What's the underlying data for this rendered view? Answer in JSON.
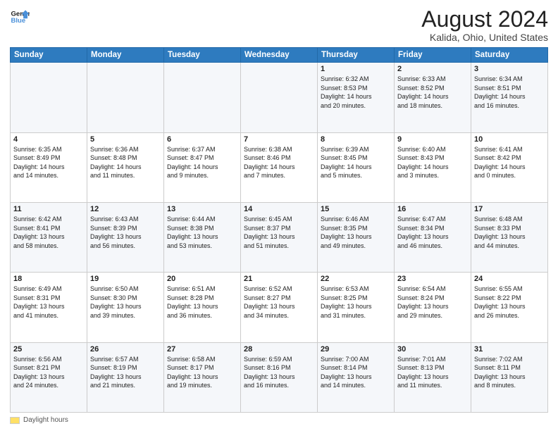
{
  "header": {
    "logo_line1": "General",
    "logo_line2": "Blue",
    "main_title": "August 2024",
    "subtitle": "Kalida, Ohio, United States"
  },
  "weekdays": [
    "Sunday",
    "Monday",
    "Tuesday",
    "Wednesday",
    "Thursday",
    "Friday",
    "Saturday"
  ],
  "weeks": [
    [
      {
        "day": "",
        "info": ""
      },
      {
        "day": "",
        "info": ""
      },
      {
        "day": "",
        "info": ""
      },
      {
        "day": "",
        "info": ""
      },
      {
        "day": "1",
        "info": "Sunrise: 6:32 AM\nSunset: 8:53 PM\nDaylight: 14 hours\nand 20 minutes."
      },
      {
        "day": "2",
        "info": "Sunrise: 6:33 AM\nSunset: 8:52 PM\nDaylight: 14 hours\nand 18 minutes."
      },
      {
        "day": "3",
        "info": "Sunrise: 6:34 AM\nSunset: 8:51 PM\nDaylight: 14 hours\nand 16 minutes."
      }
    ],
    [
      {
        "day": "4",
        "info": "Sunrise: 6:35 AM\nSunset: 8:49 PM\nDaylight: 14 hours\nand 14 minutes."
      },
      {
        "day": "5",
        "info": "Sunrise: 6:36 AM\nSunset: 8:48 PM\nDaylight: 14 hours\nand 11 minutes."
      },
      {
        "day": "6",
        "info": "Sunrise: 6:37 AM\nSunset: 8:47 PM\nDaylight: 14 hours\nand 9 minutes."
      },
      {
        "day": "7",
        "info": "Sunrise: 6:38 AM\nSunset: 8:46 PM\nDaylight: 14 hours\nand 7 minutes."
      },
      {
        "day": "8",
        "info": "Sunrise: 6:39 AM\nSunset: 8:45 PM\nDaylight: 14 hours\nand 5 minutes."
      },
      {
        "day": "9",
        "info": "Sunrise: 6:40 AM\nSunset: 8:43 PM\nDaylight: 14 hours\nand 3 minutes."
      },
      {
        "day": "10",
        "info": "Sunrise: 6:41 AM\nSunset: 8:42 PM\nDaylight: 14 hours\nand 0 minutes."
      }
    ],
    [
      {
        "day": "11",
        "info": "Sunrise: 6:42 AM\nSunset: 8:41 PM\nDaylight: 13 hours\nand 58 minutes."
      },
      {
        "day": "12",
        "info": "Sunrise: 6:43 AM\nSunset: 8:39 PM\nDaylight: 13 hours\nand 56 minutes."
      },
      {
        "day": "13",
        "info": "Sunrise: 6:44 AM\nSunset: 8:38 PM\nDaylight: 13 hours\nand 53 minutes."
      },
      {
        "day": "14",
        "info": "Sunrise: 6:45 AM\nSunset: 8:37 PM\nDaylight: 13 hours\nand 51 minutes."
      },
      {
        "day": "15",
        "info": "Sunrise: 6:46 AM\nSunset: 8:35 PM\nDaylight: 13 hours\nand 49 minutes."
      },
      {
        "day": "16",
        "info": "Sunrise: 6:47 AM\nSunset: 8:34 PM\nDaylight: 13 hours\nand 46 minutes."
      },
      {
        "day": "17",
        "info": "Sunrise: 6:48 AM\nSunset: 8:33 PM\nDaylight: 13 hours\nand 44 minutes."
      }
    ],
    [
      {
        "day": "18",
        "info": "Sunrise: 6:49 AM\nSunset: 8:31 PM\nDaylight: 13 hours\nand 41 minutes."
      },
      {
        "day": "19",
        "info": "Sunrise: 6:50 AM\nSunset: 8:30 PM\nDaylight: 13 hours\nand 39 minutes."
      },
      {
        "day": "20",
        "info": "Sunrise: 6:51 AM\nSunset: 8:28 PM\nDaylight: 13 hours\nand 36 minutes."
      },
      {
        "day": "21",
        "info": "Sunrise: 6:52 AM\nSunset: 8:27 PM\nDaylight: 13 hours\nand 34 minutes."
      },
      {
        "day": "22",
        "info": "Sunrise: 6:53 AM\nSunset: 8:25 PM\nDaylight: 13 hours\nand 31 minutes."
      },
      {
        "day": "23",
        "info": "Sunrise: 6:54 AM\nSunset: 8:24 PM\nDaylight: 13 hours\nand 29 minutes."
      },
      {
        "day": "24",
        "info": "Sunrise: 6:55 AM\nSunset: 8:22 PM\nDaylight: 13 hours\nand 26 minutes."
      }
    ],
    [
      {
        "day": "25",
        "info": "Sunrise: 6:56 AM\nSunset: 8:21 PM\nDaylight: 13 hours\nand 24 minutes."
      },
      {
        "day": "26",
        "info": "Sunrise: 6:57 AM\nSunset: 8:19 PM\nDaylight: 13 hours\nand 21 minutes."
      },
      {
        "day": "27",
        "info": "Sunrise: 6:58 AM\nSunset: 8:17 PM\nDaylight: 13 hours\nand 19 minutes."
      },
      {
        "day": "28",
        "info": "Sunrise: 6:59 AM\nSunset: 8:16 PM\nDaylight: 13 hours\nand 16 minutes."
      },
      {
        "day": "29",
        "info": "Sunrise: 7:00 AM\nSunset: 8:14 PM\nDaylight: 13 hours\nand 14 minutes."
      },
      {
        "day": "30",
        "info": "Sunrise: 7:01 AM\nSunset: 8:13 PM\nDaylight: 13 hours\nand 11 minutes."
      },
      {
        "day": "31",
        "info": "Sunrise: 7:02 AM\nSunset: 8:11 PM\nDaylight: 13 hours\nand 8 minutes."
      }
    ]
  ],
  "footer": {
    "daylight_label": "Daylight hours",
    "daylight_color": "#ffe066"
  },
  "colors": {
    "header_bg": "#2e7bbf",
    "odd_row": "#f5f7fa",
    "even_row": "#ffffff"
  }
}
